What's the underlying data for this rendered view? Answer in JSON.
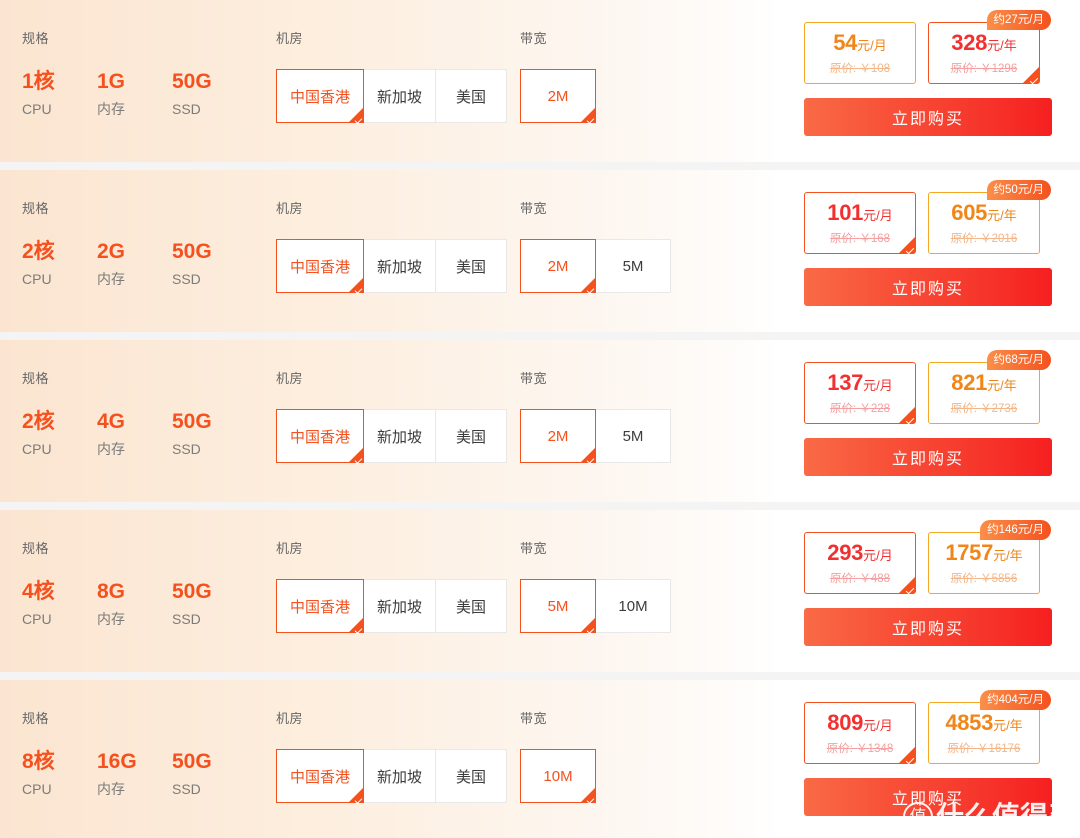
{
  "labels": {
    "spec": "规格",
    "region": "机房",
    "bandwidth": "带宽",
    "cpu_unit": "CPU",
    "memory_unit": "内存",
    "disk_unit": "SSD",
    "buy": "立即购买",
    "orig_prefix": "原价: ￥"
  },
  "colors": {
    "accent_orange": "#F4511E",
    "gold": "#F5A623",
    "red": "#F23030",
    "panel_peach": "#FBE5D1",
    "button_from": "#F96A45",
    "button_to": "#F52020"
  },
  "watermark": {
    "logo_char": "值",
    "text": "什么值得买"
  },
  "plans": [
    {
      "cpu": "1核",
      "memory": "1G",
      "disk": "50G",
      "regions": [
        {
          "label": "中国香港",
          "selected": true
        },
        {
          "label": "新加坡",
          "selected": false
        },
        {
          "label": "美国",
          "selected": false
        }
      ],
      "bandwidths": [
        {
          "label": "2M",
          "selected": true
        }
      ],
      "prices": [
        {
          "amount": "54",
          "suffix": "元/月",
          "original": "原价: ￥108",
          "selected": false,
          "style": "gold",
          "badge": null
        },
        {
          "amount": "328",
          "suffix": "元/年",
          "original": "原价: ￥1296",
          "selected": true,
          "style": "red",
          "badge": "约27元/月"
        }
      ],
      "buy_label": "立即购买"
    },
    {
      "cpu": "2核",
      "memory": "2G",
      "disk": "50G",
      "regions": [
        {
          "label": "中国香港",
          "selected": true
        },
        {
          "label": "新加坡",
          "selected": false
        },
        {
          "label": "美国",
          "selected": false
        }
      ],
      "bandwidths": [
        {
          "label": "2M",
          "selected": true
        },
        {
          "label": "5M",
          "selected": false
        }
      ],
      "prices": [
        {
          "amount": "101",
          "suffix": "元/月",
          "original": "原价: ￥168",
          "selected": true,
          "style": "red",
          "badge": null
        },
        {
          "amount": "605",
          "suffix": "元/年",
          "original": "原价: ￥2016",
          "selected": false,
          "style": "gold",
          "badge": "约50元/月"
        }
      ],
      "buy_label": "立即购买"
    },
    {
      "cpu": "2核",
      "memory": "4G",
      "disk": "50G",
      "regions": [
        {
          "label": "中国香港",
          "selected": true
        },
        {
          "label": "新加坡",
          "selected": false
        },
        {
          "label": "美国",
          "selected": false
        }
      ],
      "bandwidths": [
        {
          "label": "2M",
          "selected": true
        },
        {
          "label": "5M",
          "selected": false
        }
      ],
      "prices": [
        {
          "amount": "137",
          "suffix": "元/月",
          "original": "原价: ￥228",
          "selected": true,
          "style": "red",
          "badge": null
        },
        {
          "amount": "821",
          "suffix": "元/年",
          "original": "原价: ￥2736",
          "selected": false,
          "style": "gold",
          "badge": "约68元/月"
        }
      ],
      "buy_label": "立即购买"
    },
    {
      "cpu": "4核",
      "memory": "8G",
      "disk": "50G",
      "regions": [
        {
          "label": "中国香港",
          "selected": true
        },
        {
          "label": "新加坡",
          "selected": false
        },
        {
          "label": "美国",
          "selected": false
        }
      ],
      "bandwidths": [
        {
          "label": "5M",
          "selected": true
        },
        {
          "label": "10M",
          "selected": false
        }
      ],
      "prices": [
        {
          "amount": "293",
          "suffix": "元/月",
          "original": "原价: ￥488",
          "selected": true,
          "style": "red",
          "badge": null
        },
        {
          "amount": "1757",
          "suffix": "元/年",
          "original": "原价: ￥5856",
          "selected": false,
          "style": "gold",
          "badge": "约146元/月"
        }
      ],
      "buy_label": "立即购买"
    },
    {
      "cpu": "8核",
      "memory": "16G",
      "disk": "50G",
      "regions": [
        {
          "label": "中国香港",
          "selected": true
        },
        {
          "label": "新加坡",
          "selected": false
        },
        {
          "label": "美国",
          "selected": false
        }
      ],
      "bandwidths": [
        {
          "label": "10M",
          "selected": true
        }
      ],
      "prices": [
        {
          "amount": "809",
          "suffix": "元/月",
          "original": "原价: ￥1348",
          "selected": true,
          "style": "red",
          "badge": null
        },
        {
          "amount": "4853",
          "suffix": "元/年",
          "original": "原价: ￥16176",
          "selected": false,
          "style": "gold",
          "badge": "约404元/月"
        }
      ],
      "buy_label": "立即购买"
    }
  ]
}
